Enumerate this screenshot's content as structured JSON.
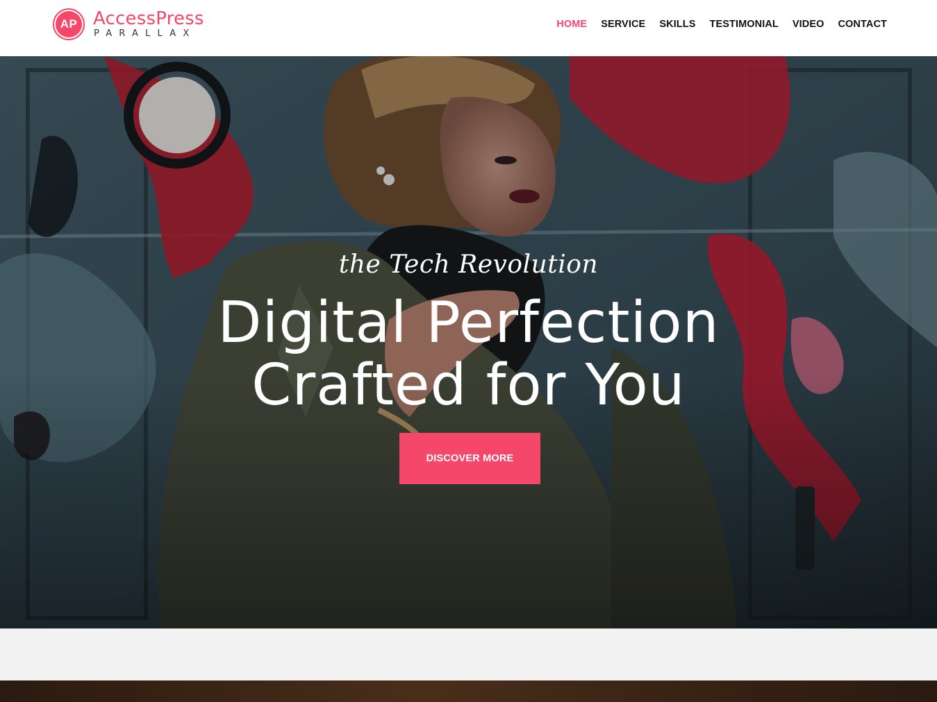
{
  "header": {
    "logo_badge": "AP",
    "logo_title": "AccessPress",
    "logo_subtitle": "PARALLAX",
    "nav": [
      {
        "label": "HOME",
        "active": true
      },
      {
        "label": "SERVICE",
        "active": false
      },
      {
        "label": "SKILLS",
        "active": false
      },
      {
        "label": "TESTIMONIAL",
        "active": false
      },
      {
        "label": "VIDEO",
        "active": false
      },
      {
        "label": "CONTACT",
        "active": false
      }
    ]
  },
  "hero": {
    "tagline": "the Tech Revolution",
    "title_line1": "Digital Perfection",
    "title_line2": "Crafted for You",
    "cta_label": "DISCOVER MORE"
  },
  "colors": {
    "accent": "#f5476a",
    "nav_text": "#111111",
    "hero_text": "#ffffff",
    "gray_band": "#f2f2f2"
  }
}
